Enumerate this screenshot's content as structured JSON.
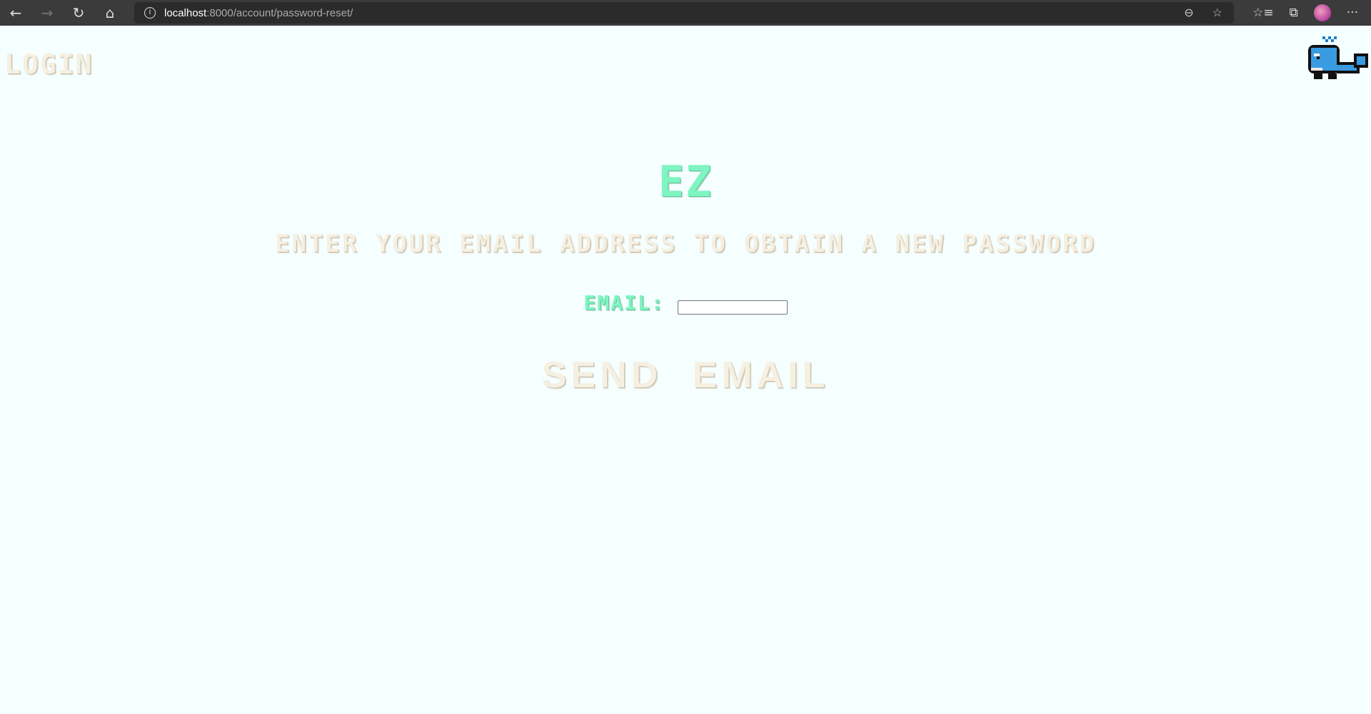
{
  "browser": {
    "url_host": "localhost",
    "url_path": ":8000/account/password-reset/"
  },
  "nav": {
    "login": "LOGIN"
  },
  "main": {
    "logo": "EZ",
    "heading": "ENTER YOUR EMAIL ADDRESS TO OBTAIN A NEW PASSWORD",
    "email_label": "EMAIL:",
    "email_value": "",
    "send_button": "SEND EMAIL"
  },
  "colors": {
    "accent": "#7ef5c2",
    "text": "#f6f0e2",
    "background": "#f5ffff"
  }
}
